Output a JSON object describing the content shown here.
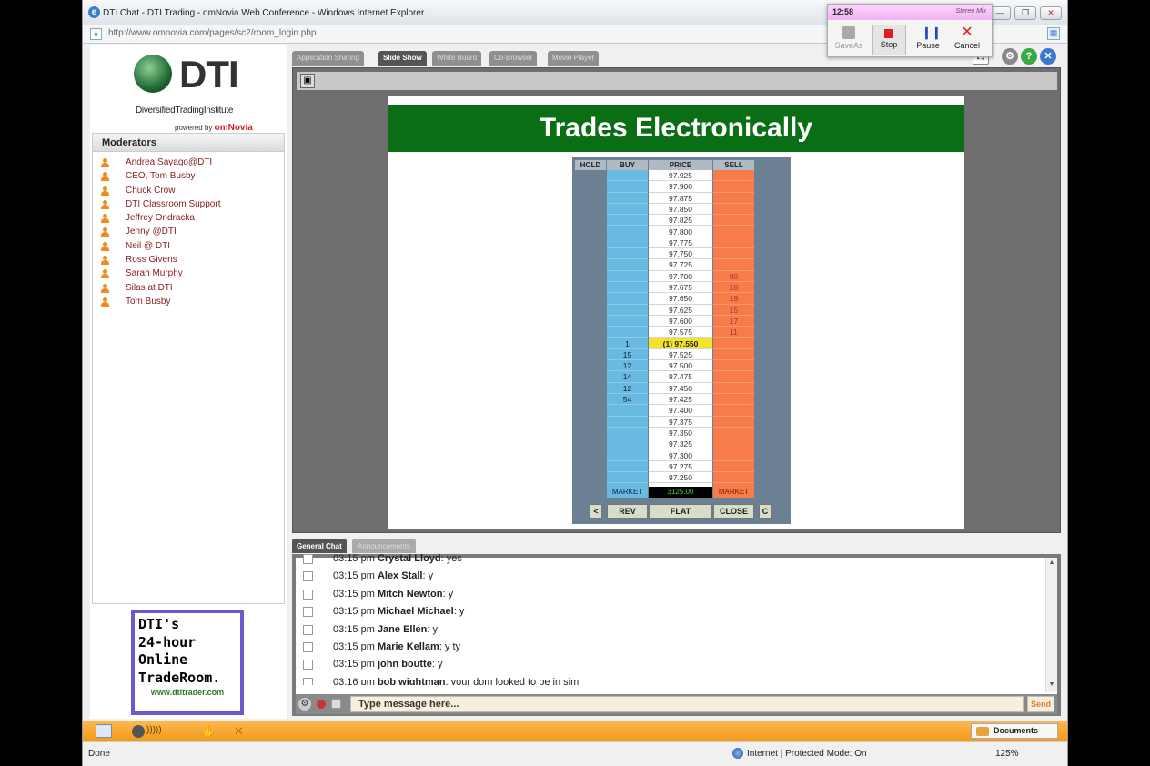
{
  "window": {
    "title": "DTI Chat - DTI Trading - omNovia Web Conference - Windows Internet Explorer",
    "url": "http://www.omnovia.com/pages/sc2/room_login.php"
  },
  "recorder": {
    "time": "12:58",
    "source": "Stereo Mix",
    "buttons": {
      "save_as": "SaveAs",
      "stop": "Stop",
      "pause": "Pause",
      "cancel": "Cancel"
    }
  },
  "logo": {
    "brand": "DTI",
    "subtitle": "DiversifiedTradingInstitute",
    "powered_by": "powered by",
    "powered_brand": "omNovia"
  },
  "moderators": {
    "header": "Moderators",
    "items": [
      "Andrea Sayago@DTI",
      "CEO, Tom Busby",
      "Chuck Crow",
      "DTI Classroom Support",
      "Jeffrey Ondracka",
      "Jenny @DTI",
      "Neil @ DTI",
      "Ross Givens",
      "Sarah Murphy",
      "Silas at DTI",
      "Tom Busby"
    ]
  },
  "ad": {
    "lines": [
      "DTI's",
      "24-hour",
      "Online",
      "TradeRoom."
    ],
    "site": "www.dtitrader.com"
  },
  "content_tabs": [
    "Application Sharing",
    "Slide Show",
    "White Board",
    "Co-Browser",
    "Movie Player"
  ],
  "active_content_tab": "Slide Show",
  "slide": {
    "title": "Trades Electronically",
    "dom": {
      "headers": {
        "hold": "HOLD",
        "buy": "BUY",
        "price": "PRICE",
        "sell": "SELL"
      },
      "prices": [
        "97.925",
        "97.900",
        "97.875",
        "97.850",
        "97.825",
        "97.800",
        "97.775",
        "97.750",
        "97.725",
        "97.700",
        "97.675",
        "97.650",
        "97.625",
        "97.600",
        "97.575",
        "(1) 97.550",
        "97.525",
        "97.500",
        "97.475",
        "97.450",
        "97.425",
        "97.400",
        "97.375",
        "97.350",
        "97.325",
        "97.300",
        "97.275",
        "97.250"
      ],
      "current_index": 15,
      "buy": [
        "",
        "",
        "",
        "",
        "",
        "",
        "",
        "",
        "",
        "",
        "",
        "",
        "",
        "",
        "",
        "1",
        "15",
        "12",
        "14",
        "12",
        "54",
        "",
        "",
        "",
        "",
        "",
        "",
        ""
      ],
      "sell": [
        "",
        "",
        "",
        "",
        "",
        "",
        "",
        "",
        "",
        "80",
        "18",
        "19",
        "15",
        "17",
        "11",
        "",
        "",
        "",
        "",
        "",
        "",
        "",
        "",
        "",
        "",
        "",
        "",
        ""
      ],
      "market_left": "MARKET",
      "market_value": "3125.00",
      "market_right": "MARKET",
      "buttons": [
        "<",
        "REV",
        "FLAT",
        "CLOSE",
        "C"
      ]
    }
  },
  "chat": {
    "tabs": [
      "General Chat",
      "Announcements"
    ],
    "active_tab": "General Chat",
    "messages": [
      {
        "time": "03:15 pm",
        "user": "Crystal Lloyd",
        "text": "yes"
      },
      {
        "time": "03:15 pm",
        "user": "Alex Stall",
        "text": "y"
      },
      {
        "time": "03:15 pm",
        "user": "Mitch Newton",
        "text": "y"
      },
      {
        "time": "03:15 pm",
        "user": "Michael Michael",
        "text": "y"
      },
      {
        "time": "03:15 pm",
        "user": "Jane Ellen",
        "text": "y"
      },
      {
        "time": "03:15 pm",
        "user": "Marie Kellam",
        "text": "y ty"
      },
      {
        "time": "03:15 pm",
        "user": "john boutte",
        "text": "y"
      },
      {
        "time": "03:16 pm",
        "user": "bob wightman",
        "text": "your dom looked to be in sim"
      }
    ],
    "input_placeholder": "Type message here...",
    "send_label": "Send"
  },
  "taskbar": {
    "documents_label": "Documents"
  },
  "statusbar": {
    "status": "Done",
    "zone": "Internet | Protected Mode: On",
    "zoom": "125%"
  },
  "colors": {
    "slide_banner": "#0a6e14",
    "buy_column": "#6ab9e0",
    "sell_column": "#f77c4a",
    "current_price": "#f5e22a",
    "taskbar": "#f39a1a",
    "moderator_text": "#8a1a1a"
  }
}
